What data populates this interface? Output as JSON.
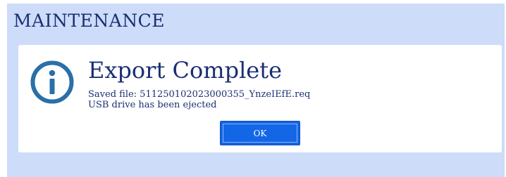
{
  "panel": {
    "title": "MAINTENANCE"
  },
  "dialog": {
    "icon": "info-icon",
    "title": "Export Complete",
    "messages": [
      "Saved file: 511250102023000355_YnzeIEfE.req",
      "USB drive has been ejected"
    ],
    "ok_label": "OK"
  },
  "colors": {
    "panel_background": "#cddcf8",
    "text": "#1a2f73",
    "icon": "#2a6fa8",
    "button": "#1366e6"
  }
}
